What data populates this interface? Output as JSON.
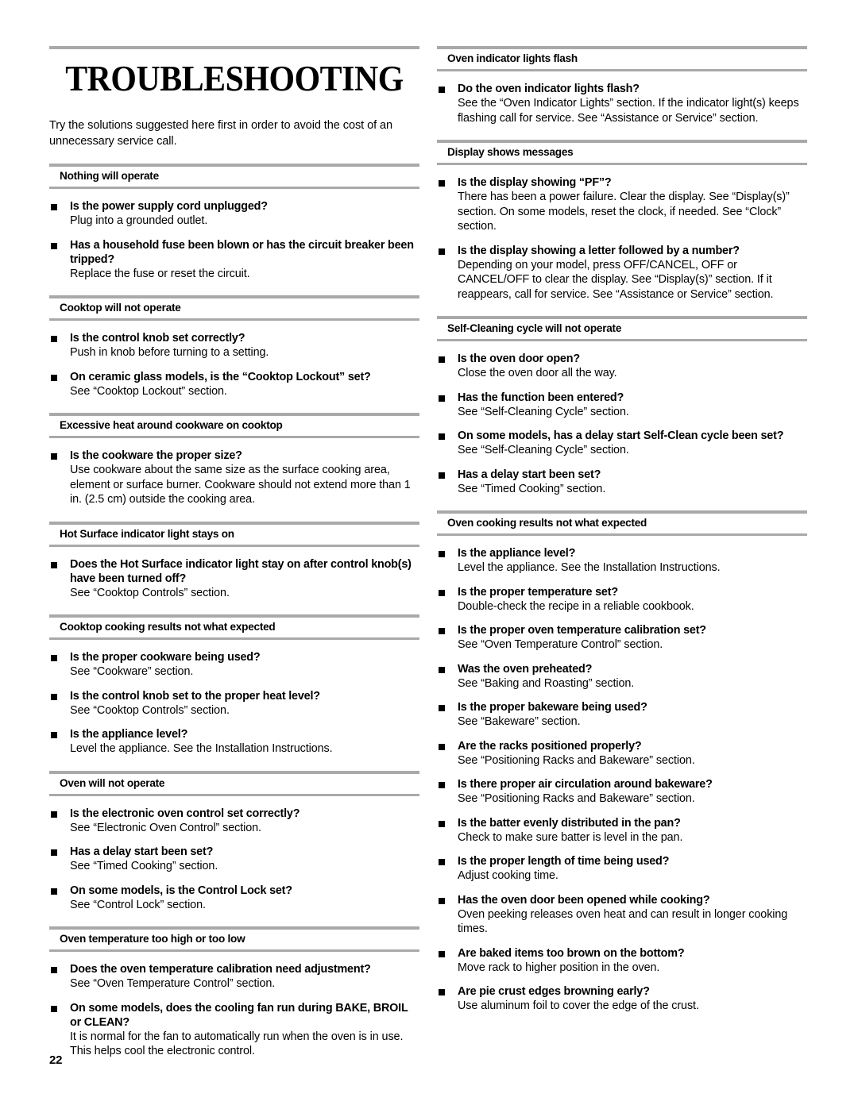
{
  "document": {
    "title": "TROUBLESHOOTING",
    "intro": "Try the solutions suggested here first in order to avoid the cost of an unnecessary service call.",
    "page_number": "22"
  },
  "left_column": {
    "sections": [
      {
        "heading": "Nothing will operate",
        "items": [
          {
            "question": "Is the power supply cord unplugged?",
            "answer": "Plug into a grounded outlet."
          },
          {
            "question": "Has a household fuse been blown or has the circuit breaker been tripped?",
            "answer": "Replace the fuse or reset the circuit."
          }
        ]
      },
      {
        "heading": "Cooktop will not operate",
        "items": [
          {
            "question": "Is the control knob set correctly?",
            "answer": "Push in knob before turning to a setting."
          },
          {
            "question": "On ceramic glass models, is the “Cooktop Lockout” set?",
            "answer": "See “Cooktop Lockout” section."
          }
        ]
      },
      {
        "heading": "Excessive heat around cookware on cooktop",
        "items": [
          {
            "question": "Is the cookware the proper size?",
            "answer": "Use cookware about the same size as the surface cooking area, element or surface burner. Cookware should not extend more than 1 in. (2.5 cm) outside the cooking area."
          }
        ]
      },
      {
        "heading": "Hot Surface indicator light stays on",
        "items": [
          {
            "question": "Does the Hot Surface indicator light stay on after control knob(s) have been turned off?",
            "answer": "See “Cooktop Controls” section."
          }
        ]
      },
      {
        "heading": "Cooktop cooking results not what expected",
        "items": [
          {
            "question": "Is the proper cookware being used?",
            "answer": "See “Cookware” section."
          },
          {
            "question": "Is the control knob set to the proper heat level?",
            "answer": "See “Cooktop Controls” section."
          },
          {
            "question": "Is the appliance level?",
            "answer": "Level the appliance. See the Installation Instructions."
          }
        ]
      },
      {
        "heading": "Oven will not operate",
        "items": [
          {
            "question": "Is the electronic oven control set correctly?",
            "answer": "See “Electronic Oven Control” section."
          },
          {
            "question": "Has a delay start been set?",
            "answer": "See “Timed Cooking” section."
          },
          {
            "question": "On some models, is the Control Lock set?",
            "answer": "See “Control Lock” section."
          }
        ]
      },
      {
        "heading": "Oven temperature too high or too low",
        "items": [
          {
            "question": "Does the oven temperature calibration need adjustment?",
            "answer": "See “Oven Temperature Control” section."
          },
          {
            "question": "On some models, does the cooling fan run during BAKE, BROIL or CLEAN?",
            "answer": "It is normal for the fan to automatically run when the oven is in use. This helps cool the electronic control."
          }
        ]
      }
    ]
  },
  "right_column": {
    "sections": [
      {
        "heading": "Oven indicator lights flash",
        "items": [
          {
            "question": "Do the oven indicator lights flash?",
            "answer": "See the “Oven Indicator Lights” section. If the indicator light(s) keeps flashing call for service. See “Assistance or Service” section."
          }
        ]
      },
      {
        "heading": "Display shows messages",
        "items": [
          {
            "question": "Is the display showing “PF”?",
            "answer": "There has been a power failure. Clear the display. See “Display(s)” section. On some models, reset the clock, if needed. See “Clock” section."
          },
          {
            "question": "Is the display showing a letter followed by a number?",
            "answer": "Depending on your model, press OFF/CANCEL, OFF or CANCEL/OFF to clear the display. See “Display(s)” section. If it reappears, call for service. See “Assistance or Service” section."
          }
        ]
      },
      {
        "heading": "Self-Cleaning cycle will not operate",
        "items": [
          {
            "question": "Is the oven door open?",
            "answer": "Close the oven door all the way."
          },
          {
            "question": "Has the function been entered?",
            "answer": "See “Self-Cleaning Cycle” section."
          },
          {
            "question": "On some models, has a delay start Self-Clean cycle been set?",
            "answer": "See “Self-Cleaning Cycle” section."
          },
          {
            "question": "Has a delay start been set?",
            "answer": "See “Timed Cooking” section."
          }
        ]
      },
      {
        "heading": "Oven cooking results not what expected",
        "items": [
          {
            "question": "Is the appliance level?",
            "answer": "Level the appliance. See the Installation Instructions."
          },
          {
            "question": "Is the proper temperature set?",
            "answer": "Double-check the recipe in a reliable cookbook."
          },
          {
            "question": "Is the proper oven temperature calibration set?",
            "answer": "See “Oven Temperature Control” section."
          },
          {
            "question": "Was the oven preheated?",
            "answer": "See “Baking and Roasting” section."
          },
          {
            "question": "Is the proper bakeware being used?",
            "answer": "See “Bakeware” section."
          },
          {
            "question": "Are the racks positioned properly?",
            "answer": "See “Positioning Racks and Bakeware” section."
          },
          {
            "question": "Is there proper air circulation around bakeware?",
            "answer": "See “Positioning Racks and Bakeware” section."
          },
          {
            "question": "Is the batter evenly distributed in the pan?",
            "answer": "Check to make sure batter is level in the pan."
          },
          {
            "question": "Is the proper length of time being used?",
            "answer": "Adjust cooking time."
          },
          {
            "question": "Has the oven door been opened while cooking?",
            "answer": "Oven peeking releases oven heat and can result in longer cooking times."
          },
          {
            "question": "Are baked items too brown on the bottom?",
            "answer": "Move rack to higher position in the oven."
          },
          {
            "question": "Are pie crust edges browning early?",
            "answer": "Use aluminum foil to cover the edge of the crust."
          }
        ]
      }
    ]
  },
  "colors": {
    "rule_gray": "#a9a9a9",
    "text_black": "#000000",
    "background": "#ffffff"
  }
}
